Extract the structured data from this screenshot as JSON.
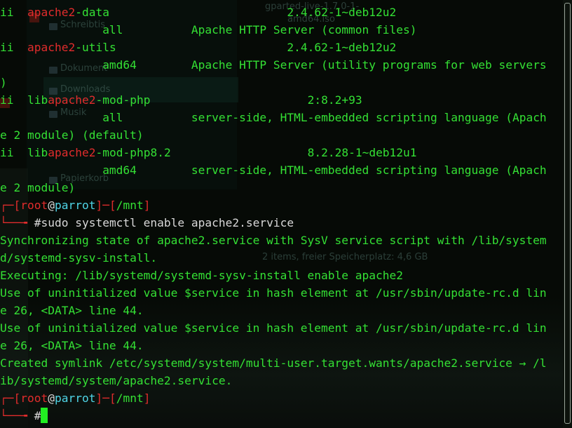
{
  "background_window": {
    "items": [
      "Schreibtis",
      "Dokument",
      "Downloads",
      "Musik",
      "Papierkorb"
    ],
    "file_label_1": "gparted-live-1.7.0-1-",
    "file_label_2": "amd64.iso",
    "status_text": "2 items, freier Speicherplatz: 4,6 GB"
  },
  "terminal": {
    "packages": [
      {
        "status": "ii",
        "pre": "",
        "match": "apache2",
        "post": "-data",
        "version": "2.4.62-1~deb12u2",
        "arch": "all",
        "desc": "Apache HTTP Server (common files)",
        "desc_wrap": ""
      },
      {
        "status": "ii",
        "pre": "",
        "match": "apache2",
        "post": "-utils",
        "version": "2.4.62-1~deb12u2",
        "arch": "amd64",
        "desc": "Apache HTTP Server (utility programs for web servers",
        "desc_wrap": ")"
      },
      {
        "status": "ii",
        "pre": "lib",
        "match": "apache2",
        "post": "-mod-php",
        "version": "2:8.2+93",
        "arch": "all",
        "desc": "server-side, HTML-embedded scripting language (Apach",
        "desc_wrap": "e 2 module) (default)"
      },
      {
        "status": "ii",
        "pre": "lib",
        "match": "apache2",
        "post": "-mod-php8.2",
        "version": "8.2.28-1~deb12u1",
        "arch": "amd64",
        "desc": "server-side, HTML-embedded scripting language (Apach",
        "desc_wrap": "e 2 module)"
      }
    ],
    "prompt": {
      "user": "root",
      "at": "@",
      "host": "parrot",
      "path": "/mnt",
      "symbol": "#"
    },
    "command": "sudo systemctl enable apache2.service",
    "output": [
      "Synchronizing state of apache2.service with SysV service script with /lib/system",
      "d/systemd-sysv-install.",
      "Executing: /lib/systemd/systemd-sysv-install enable apache2",
      "Use of uninitialized value $service in hash element at /usr/sbin/update-rc.d lin",
      "e 26, <DATA> line 44.",
      "Use of uninitialized value $service in hash element at /usr/sbin/update-rc.d lin",
      "e 26, <DATA> line 44.",
      "Created symlink /etc/systemd/system/multi-user.target.wants/apache2.service → /l",
      "ib/systemd/system/apache2.service."
    ]
  },
  "colors": {
    "terminal_text": "#34e034",
    "highlight": "#e02c2c",
    "prompt_host": "#4fd4e6",
    "cursor": "#22ee22",
    "background": "#060a06"
  }
}
